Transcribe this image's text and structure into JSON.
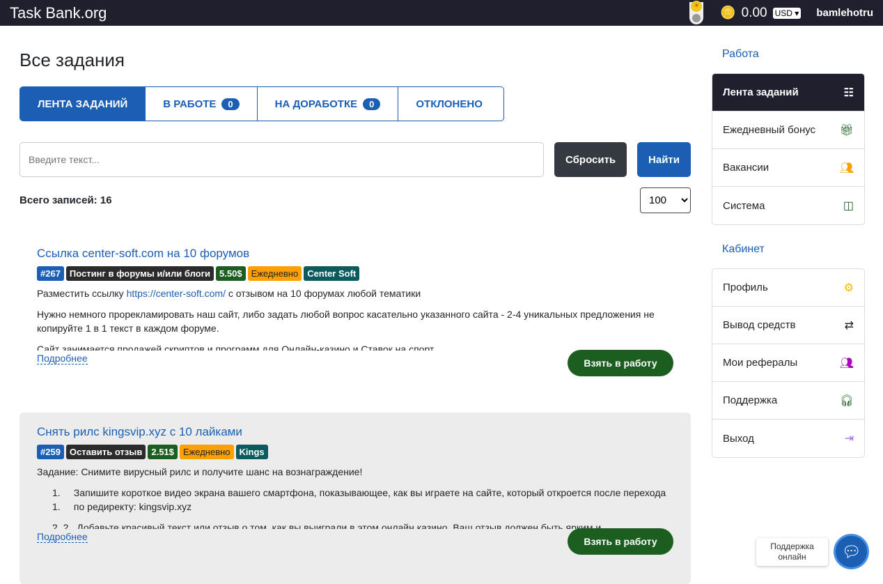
{
  "header": {
    "logo": "Task Bank.org",
    "balance": "0.00",
    "currency": "USD",
    "username": "bamlehotru"
  },
  "page": {
    "title": "Все задания"
  },
  "tabs": [
    {
      "label": "ЛЕНТА ЗАДАНИЙ"
    },
    {
      "label": "В РАБОТЕ",
      "count": "0"
    },
    {
      "label": "НА ДОРАБОТКЕ",
      "count": "0"
    },
    {
      "label": "ОТКЛОНЕНО"
    }
  ],
  "search": {
    "placeholder": "Введите текст...",
    "reset_label": "Сбросить",
    "find_label": "Найти"
  },
  "total": "Всего записей: 16",
  "per_page": "100",
  "tasks": [
    {
      "title": "Ссылка center-soft.com на 10 форумов",
      "id": "#267",
      "category": "Постинг в форумы и/или блоги",
      "price": "5.50$",
      "frequency": "Ежедневно",
      "owner": "Center Soft",
      "desc_prefix": "Разместить ссылку ",
      "desc_link": "https://center-soft.com/",
      "desc_suffix": " с отзывом на 10 форумах любой тематики",
      "p2": "Нужно немного прорекламировать наш сайт, либо задать любой вопрос касательно указанного сайта - 2-4 уникальных предложения не копируйте 1 в 1 текст в каждом форуме.",
      "p3": "Сайт занимается продажей скриптов и программ для Онлайн-казино и Ставок на спорт",
      "more": "Подробнее",
      "take": "Взять в работу"
    },
    {
      "title": "Снять рилс kingsvip.xyz с 10 лайками",
      "id": "#259",
      "category": "Оставить отзыв",
      "price": "2.51$",
      "frequency": "Ежедневно",
      "owner": "Kings",
      "p1": "Задание: Снимите вирусный рилс и получите шанс на вознаграждение!",
      "items": [
        {
          "num": "1. 1.",
          "text": "Запишите короткое видео экрана вашего смартфона, показывающее, как вы играете на сайте, который откроется после перехода по редиректу: kingsvip.xyz"
        },
        {
          "num": "2. 2.",
          "text": "Добавьте красивый текст или отзыв о том, как вы выиграли в этом онлайн казино. Ваш отзыв должен быть ярким и"
        }
      ],
      "more": "Подробнее",
      "take": "Взять в работу"
    }
  ],
  "sidebar": {
    "work_title": "Работа",
    "work": [
      {
        "label": "Лента заданий",
        "icon": "tasks-icon"
      },
      {
        "label": "Ежедневный бонус",
        "icon": "gift-icon"
      },
      {
        "label": "Вакансии",
        "icon": "users-icon"
      },
      {
        "label": "Система",
        "icon": "layout-icon"
      }
    ],
    "cabinet_title": "Кабинет",
    "cabinet": [
      {
        "label": "Профиль",
        "icon": "gear-icon"
      },
      {
        "label": "Вывод средств",
        "icon": "money-icon"
      },
      {
        "label": "Мои рефералы",
        "icon": "users-icon"
      },
      {
        "label": "Поддержка",
        "icon": "headset-icon"
      },
      {
        "label": "Выход",
        "icon": "logout-icon"
      }
    ]
  },
  "chat": {
    "label": "Поддержка онлайн"
  },
  "colors": {
    "primary": "#1a5fb4",
    "dark": "#1f1f2e",
    "green": "#1b5e20",
    "orange": "#ffa000",
    "teal": "#0b5a5e"
  }
}
